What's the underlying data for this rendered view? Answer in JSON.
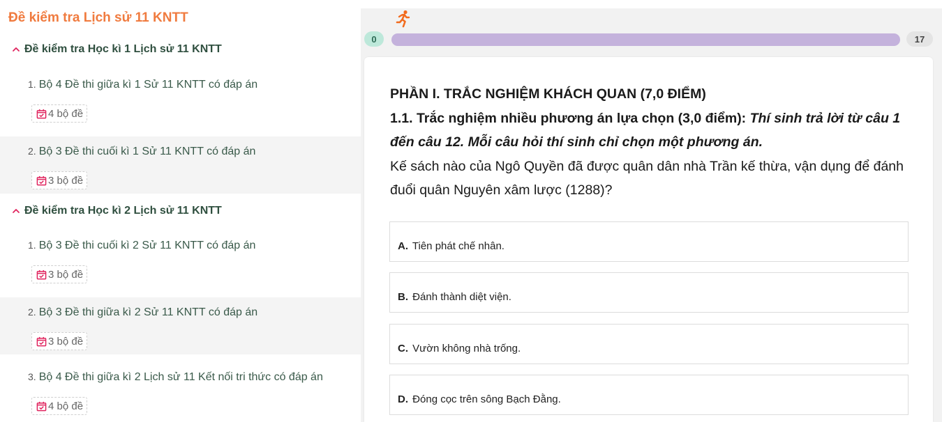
{
  "sidebar": {
    "title": "Đề kiểm tra Lịch sử 11 KNTT",
    "sections": [
      {
        "heading": "Đề kiểm tra Học kì 1 Lịch sử 11 KNTT",
        "items": [
          {
            "num": "1.",
            "title": "Bộ 4 Đề thi giữa kì 1 Sử 11 KNTT có đáp án",
            "badge": "4 bộ đề"
          },
          {
            "num": "2.",
            "title": "Bộ 3 Đề thi cuối kì 1 Sử 11 KNTT có đáp án",
            "badge": "3 bộ đề"
          }
        ]
      },
      {
        "heading": "Đề kiểm tra Học kì 2 Lịch sử 11 KNTT",
        "items": [
          {
            "num": "1.",
            "title": "Bộ 3 Đề thi cuối kì 2 Sử 11 KNTT có đáp án",
            "badge": "3 bộ đề"
          },
          {
            "num": "2.",
            "title": "Bộ 3 Đề thi giữa kì 2 Sử 11 KNTT có đáp án",
            "badge": "3 bộ đề"
          },
          {
            "num": "3.",
            "title": "Bộ 4 Đề thi giữa kì 2 Lịch sử 11 Kết nối tri thức có đáp án",
            "badge": "4 bộ đề"
          }
        ]
      }
    ]
  },
  "progress": {
    "start_label": "0",
    "end_label": "17",
    "current": 0,
    "total": 17,
    "bar_color": "#c4b2dc",
    "start_badge_color": "#bde8da"
  },
  "question": {
    "part_heading": "PHẦN I. TRẮC NGHIỆM KHÁCH QUAN (7,0 ĐIỂM)",
    "sub_heading": "1.1. Trắc nghiệm nhiều phương án lựa chọn (3,0 điểm):",
    "instruction": "Thí sinh trả lời từ câu 1 đến câu 12. Mỗi câu hỏi thí sinh chỉ chọn một phương án.",
    "prompt": "Kế sách nào của Ngô Quyền đã được quân dân nhà Trần kế thừa, vận dụng để đánh đuổi quân Nguyên xâm lược (1288)?",
    "options": [
      {
        "letter": "A.",
        "text": "Tiên phát chế nhân."
      },
      {
        "letter": "B.",
        "text": "Đánh thành diệt viện."
      },
      {
        "letter": "C.",
        "text": "Vườn không nhà trống."
      },
      {
        "letter": "D.",
        "text": "Đóng cọc trên sông Bạch Đằng."
      }
    ]
  },
  "colors": {
    "title_orange": "#f07b3f",
    "heading_green": "#2f4f3f",
    "calendar_pink": "#e0245e",
    "runner_orange": "#f26b1d"
  },
  "icons": {
    "section_toggle": "chevron-up-icon",
    "badge": "calendar-check-icon",
    "progress": "running-person-icon"
  }
}
